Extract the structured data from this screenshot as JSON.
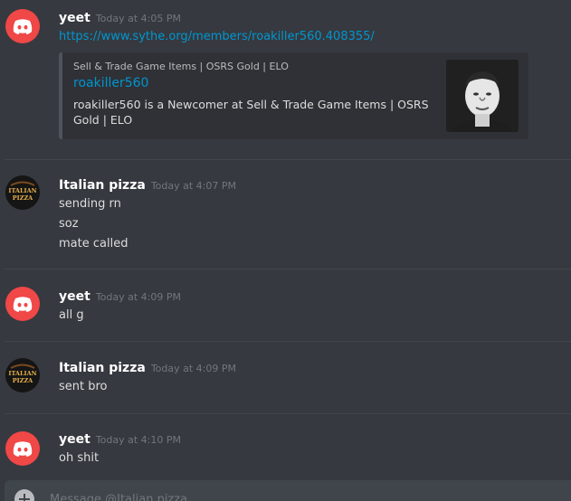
{
  "colors": {
    "background": "#36393f",
    "discord_red": "#f04747",
    "link": "#0096cf",
    "username": "#ffffff",
    "timestamp": "#72767d"
  },
  "messages": [
    {
      "author": "yeet",
      "avatar": "discord-logo-icon",
      "timestamp": "Today at 4:05 PM",
      "lines": [
        "https://www.sythe.org/members/roakiller560.408355/"
      ],
      "embed": {
        "provider": "Sell & Trade Game Items | OSRS Gold | ELO",
        "title": "roakiller560",
        "description": "roakiller560 is a Newcomer at Sell & Trade Game Items | OSRS Gold | ELO",
        "thumbnail": "profile-photo"
      }
    },
    {
      "author": "Italian pizza",
      "avatar": "italian-pizza-logo",
      "avatar_text": [
        "ITALIAN",
        "PIZZA"
      ],
      "timestamp": "Today at 4:07 PM",
      "lines": [
        "sending rn",
        "soz",
        "mate called"
      ]
    },
    {
      "author": "yeet",
      "avatar": "discord-logo-icon",
      "timestamp": "Today at 4:09 PM",
      "lines": [
        "all g"
      ]
    },
    {
      "author": "Italian pizza",
      "avatar": "italian-pizza-logo",
      "avatar_text": [
        "ITALIAN",
        "PIZZA"
      ],
      "timestamp": "Today at 4:09 PM",
      "lines": [
        "sent bro"
      ]
    },
    {
      "author": "yeet",
      "avatar": "discord-logo-icon",
      "timestamp": "Today at 4:10 PM",
      "lines": [
        "oh shit"
      ]
    }
  ],
  "composer": {
    "placeholder": "Message @Italian pizza",
    "add_icon": "plus-circle-icon"
  }
}
